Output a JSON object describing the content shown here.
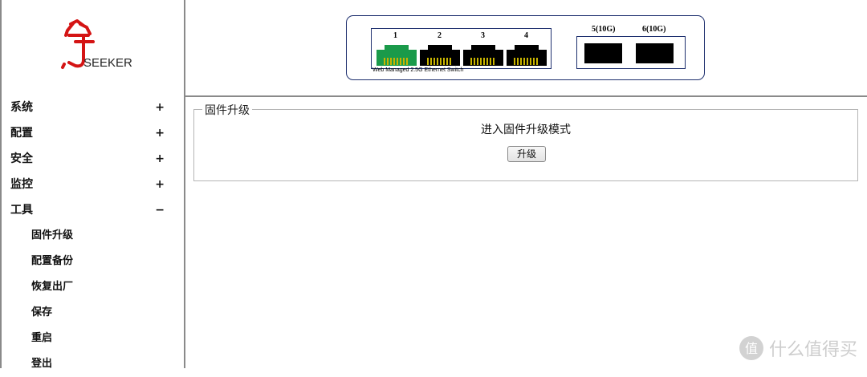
{
  "logo": {
    "brand_text": "SEEKER"
  },
  "menu": {
    "items": [
      {
        "label": "系统",
        "toggle": "+"
      },
      {
        "label": "配置",
        "toggle": "+"
      },
      {
        "label": "安全",
        "toggle": "+"
      },
      {
        "label": "监控",
        "toggle": "+"
      },
      {
        "label": "工具",
        "toggle": "−"
      }
    ],
    "subitems": [
      "固件升级",
      "配置备份",
      "恢复出厂",
      "保存",
      "重启",
      "登出"
    ]
  },
  "switch_panel": {
    "ports": [
      "1",
      "2",
      "3",
      "4"
    ],
    "sfp_ports": [
      "5(10G)",
      "6(10G)"
    ],
    "caption": "Web Managed 2.5G Ethernet Switch",
    "active_port_color": "#1a9a4a",
    "idle_port_color": "#000000",
    "contact_color": "#c8b400"
  },
  "firmware": {
    "legend": "固件升级",
    "title": "进入固件升级模式",
    "button": "升级"
  },
  "watermark": {
    "text": "什么值得买",
    "logo_glyph": "值"
  }
}
